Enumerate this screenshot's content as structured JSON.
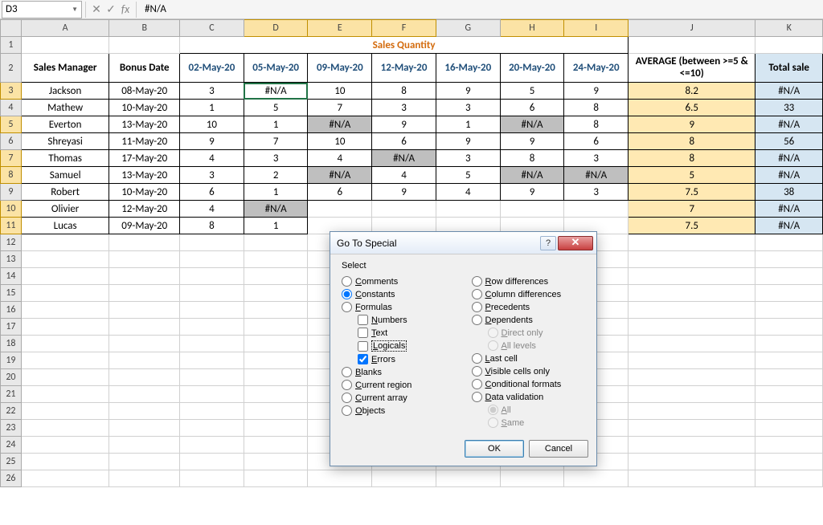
{
  "formula_bar": {
    "name_box": "D3",
    "formula": "#N/A"
  },
  "columns": [
    "A",
    "B",
    "C",
    "D",
    "E",
    "F",
    "G",
    "H",
    "I",
    "J",
    "K"
  ],
  "title_cell": "Sales Quantity",
  "headers": {
    "sales_manager": "Sales Manager",
    "bonus_date": "Bonus Date",
    "dates": [
      "02-May-20",
      "05-May-20",
      "09-May-20",
      "12-May-20",
      "16-May-20",
      "20-May-20",
      "24-May-20"
    ],
    "average": "AVERAGE (between >=5 & <=10)",
    "total_sale": "Total sale"
  },
  "rows": [
    {
      "mgr": "Jackson",
      "bonus": "08-May-20",
      "q": [
        "3",
        "#N/A",
        "10",
        "8",
        "9",
        "5",
        "9"
      ],
      "avg": "8.2",
      "tot": "#N/A"
    },
    {
      "mgr": "Mathew",
      "bonus": "10-May-20",
      "q": [
        "1",
        "5",
        "7",
        "3",
        "3",
        "6",
        "8"
      ],
      "avg": "6.5",
      "tot": "33"
    },
    {
      "mgr": "Everton",
      "bonus": "13-May-20",
      "q": [
        "10",
        "1",
        "#N/A",
        "9",
        "1",
        "#N/A",
        "8"
      ],
      "avg": "9",
      "tot": "#N/A"
    },
    {
      "mgr": "Shreyasi",
      "bonus": "11-May-20",
      "q": [
        "9",
        "7",
        "10",
        "6",
        "9",
        "9",
        "6"
      ],
      "avg": "8",
      "tot": "56"
    },
    {
      "mgr": "Thomas",
      "bonus": "17-May-20",
      "q": [
        "4",
        "3",
        "4",
        "#N/A",
        "3",
        "8",
        "3"
      ],
      "avg": "8",
      "tot": "#N/A"
    },
    {
      "mgr": "Samuel",
      "bonus": "13-May-20",
      "q": [
        "3",
        "2",
        "#N/A",
        "4",
        "5",
        "#N/A",
        "#N/A"
      ],
      "avg": "5",
      "tot": "#N/A"
    },
    {
      "mgr": "Robert",
      "bonus": "10-May-20",
      "q": [
        "6",
        "1",
        "6",
        "9",
        "4",
        "9",
        "3"
      ],
      "avg": "7.5",
      "tot": "38"
    },
    {
      "mgr": "Olivier",
      "bonus": "12-May-20",
      "q": [
        "4",
        "#N/A",
        "",
        "",
        "",
        "",
        ""
      ],
      "avg": "7",
      "tot": "#N/A"
    },
    {
      "mgr": "Lucas",
      "bonus": "09-May-20",
      "q": [
        "8",
        "1",
        "",
        "",
        "",
        "",
        ""
      ],
      "avg": "7.5",
      "tot": "#N/A"
    }
  ],
  "selected_row_headers": [
    3,
    5,
    7,
    8,
    10,
    11
  ],
  "selected_col_headers": [
    "D",
    "E",
    "F",
    "H",
    "I"
  ],
  "active_cell": "D3",
  "dialog": {
    "title": "Go To Special",
    "section_label": "Select",
    "left_options": [
      {
        "id": "comments",
        "label": "Comments",
        "type": "radio",
        "checked": false
      },
      {
        "id": "constants",
        "label": "Constants",
        "type": "radio",
        "checked": true
      },
      {
        "id": "formulas",
        "label": "Formulas",
        "type": "radio",
        "checked": false
      },
      {
        "id": "numbers",
        "label": "Numbers",
        "type": "checkbox",
        "checked": false,
        "child": true
      },
      {
        "id": "text",
        "label": "Text",
        "type": "checkbox",
        "checked": false,
        "child": true
      },
      {
        "id": "logicals",
        "label": "Logicals",
        "type": "checkbox",
        "checked": false,
        "child": true,
        "focus": true
      },
      {
        "id": "errors",
        "label": "Errors",
        "type": "checkbox",
        "checked": true,
        "child": true
      },
      {
        "id": "blanks",
        "label": "Blanks",
        "type": "radio",
        "checked": false
      },
      {
        "id": "current_region",
        "label": "Current region",
        "type": "radio",
        "checked": false
      },
      {
        "id": "current_array",
        "label": "Current array",
        "type": "radio",
        "checked": false
      },
      {
        "id": "objects",
        "label": "Objects",
        "type": "radio",
        "checked": false
      }
    ],
    "right_options": [
      {
        "id": "row_diff",
        "label": "Row differences",
        "type": "radio",
        "checked": false
      },
      {
        "id": "col_diff",
        "label": "Column differences",
        "type": "radio",
        "checked": false
      },
      {
        "id": "precedents",
        "label": "Precedents",
        "type": "radio",
        "checked": false
      },
      {
        "id": "dependents",
        "label": "Dependents",
        "type": "radio",
        "checked": false
      },
      {
        "id": "direct_only",
        "label": "Direct only",
        "type": "radio",
        "checked": true,
        "child": true,
        "disabled": true
      },
      {
        "id": "all_levels",
        "label": "All levels",
        "type": "radio",
        "checked": false,
        "child": true,
        "disabled": true
      },
      {
        "id": "last_cell",
        "label": "Last cell",
        "type": "radio",
        "checked": false
      },
      {
        "id": "visible",
        "label": "Visible cells only",
        "type": "radio",
        "checked": false
      },
      {
        "id": "cond_formats",
        "label": "Conditional formats",
        "type": "radio",
        "checked": false
      },
      {
        "id": "data_val",
        "label": "Data validation",
        "type": "radio",
        "checked": false
      },
      {
        "id": "dv_all",
        "label": "All",
        "type": "radio",
        "checked": true,
        "child": true,
        "disabled": true
      },
      {
        "id": "dv_same",
        "label": "Same",
        "type": "radio",
        "checked": false,
        "child": true,
        "disabled": true
      }
    ],
    "ok": "OK",
    "cancel": "Cancel",
    "help_icon": "?",
    "close_icon": "✕"
  }
}
